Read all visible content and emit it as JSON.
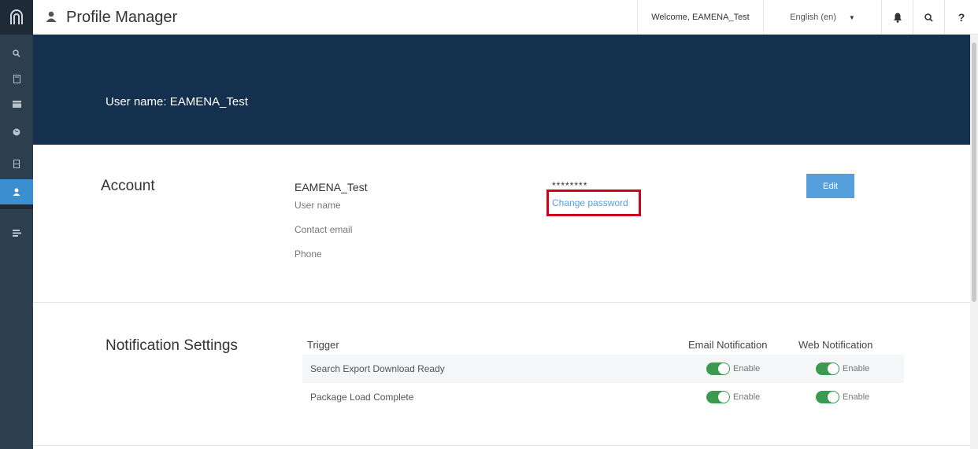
{
  "app": {
    "title": "Profile Manager",
    "welcome": "Welcome, EAMENA_Test",
    "language": "English (en)",
    "help_label": "?"
  },
  "sidebar": {
    "items": [
      {
        "icon": "search-icon"
      },
      {
        "icon": "bookmark-icon"
      },
      {
        "icon": "card-icon"
      },
      {
        "icon": "globe-icon"
      },
      {
        "icon": "database-icon"
      },
      {
        "icon": "user-icon",
        "active": true
      },
      {
        "icon": "list-icon"
      }
    ]
  },
  "banner": {
    "text": "User name: EAMENA_Test"
  },
  "account": {
    "section_title": "Account",
    "username_value": "EAMENA_Test",
    "username_label": "User name",
    "contact_email_label": "Contact email",
    "phone_label": "Phone",
    "password_mask": "********",
    "change_password_label": "Change password",
    "edit_label": "Edit"
  },
  "notifications": {
    "section_title": "Notification Settings",
    "headers": {
      "trigger": "Trigger",
      "email": "Email Notification",
      "web": "Web Notification"
    },
    "rows": [
      {
        "trigger": "Search Export Download Ready",
        "email": "Enable",
        "web": "Enable"
      },
      {
        "trigger": "Package Load Complete",
        "email": "Enable",
        "web": "Enable"
      }
    ]
  },
  "colors": {
    "banner": "#14304f",
    "accent": "#569fdd",
    "highlight_box": "#d0021b",
    "toggle_on": "#3a9a4f"
  }
}
